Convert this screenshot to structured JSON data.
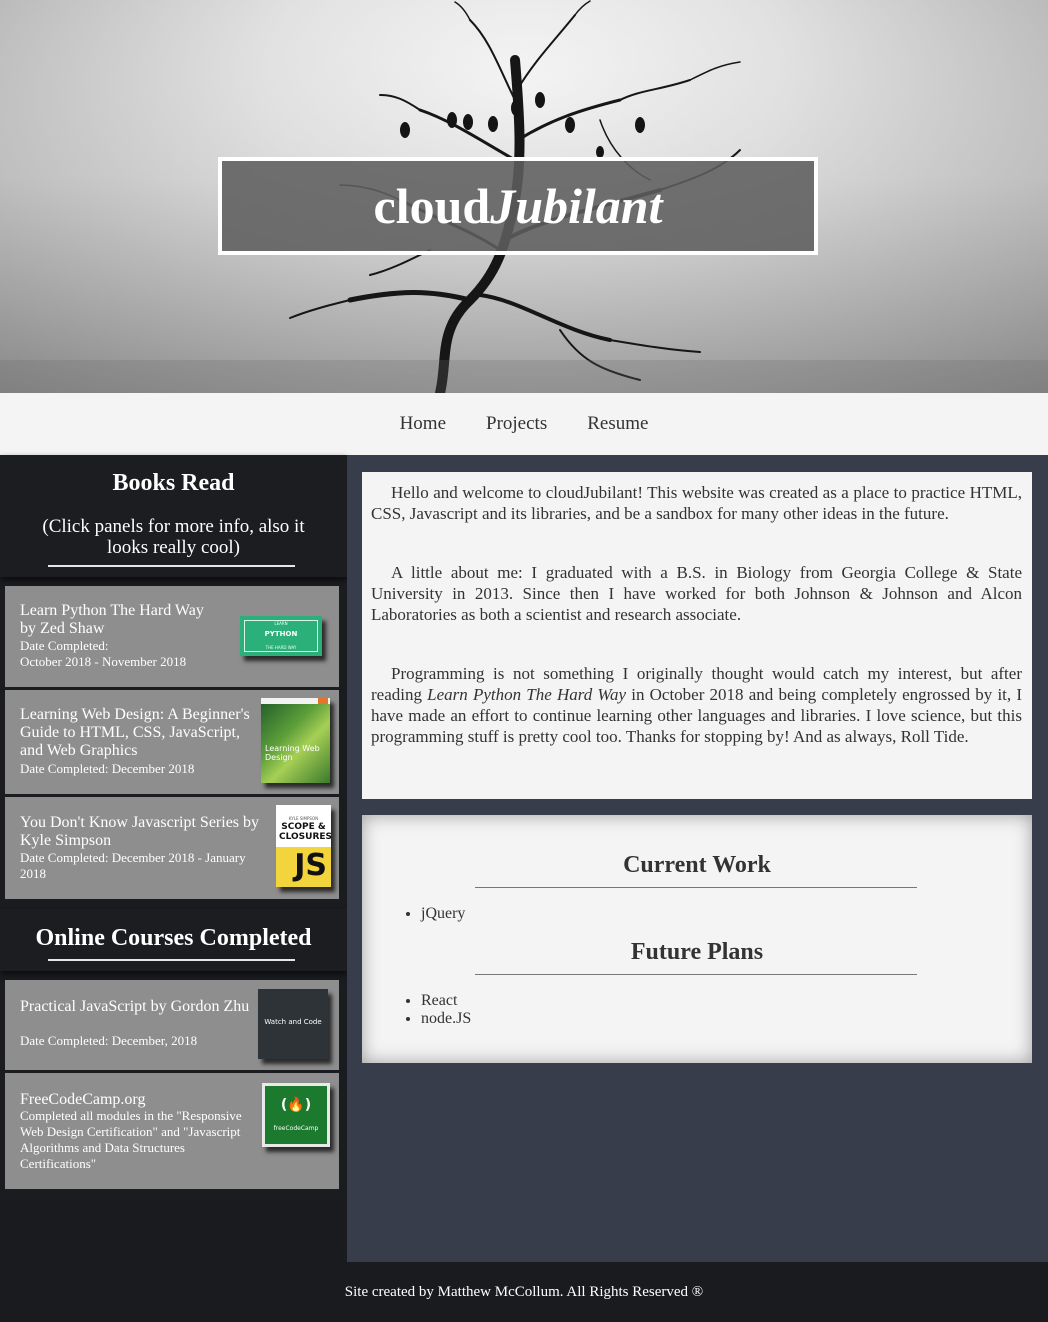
{
  "hero": {
    "title_plain": "cloud",
    "title_italic": "Jubilant"
  },
  "nav": {
    "items": [
      {
        "label": "Home"
      },
      {
        "label": "Projects"
      },
      {
        "label": "Resume"
      }
    ]
  },
  "sidebar": {
    "books": {
      "heading": "Books Read",
      "subheading": "(Click panels for more info, also it looks really cool)",
      "items": [
        {
          "title_line1": "Learn Python The Hard Way",
          "title_line2": "by Zed Shaw",
          "date_label": "Date Completed:",
          "date_value": "October 2018 - November 2018",
          "cover_top": "LEARN",
          "cover_mid": "PYTHON",
          "cover_bottom": "THE HARD WAY"
        },
        {
          "title": "Learning Web Design: A Beginner's Guide to HTML, CSS, JavaScript, and Web Graphics",
          "date": "Date Completed: December 2018",
          "cover_text": "Learning Web Design"
        },
        {
          "title": "You Don't Know Javascript Series by Kyle Simpson",
          "date": "Date Completed: December 2018 - January 2018",
          "cover_author": "KYLE SIMPSON",
          "cover_title": "SCOPE & CLOSURES",
          "cover_js": "JS"
        }
      ]
    },
    "courses": {
      "heading": "Online Courses Completed",
      "items": [
        {
          "title": "Practical JavaScript by Gordon Zhu",
          "date": "Date Completed: December, 2018",
          "cover_text": "Watch and Code"
        },
        {
          "title": "FreeCodeCamp.org",
          "desc": "Completed all modules in the \"Responsive Web Design Certification\" and \"Javascript Algorithms and Data Structures Certifications\"",
          "cover_logo": "(🔥)",
          "cover_text": "freeCodeCamp"
        }
      ]
    }
  },
  "intro": {
    "p1": "Hello and welcome to cloudJubilant! This website was created as a place to practice HTML, CSS, Javascript and its libraries, and be a sandbox for many other ideas in the future.",
    "p2": "A little about me: I graduated with a B.S. in Biology from Georgia College & State University in 2013. Since then I have worked for both Johnson & Johnson and Alcon Laboratories as both a scientist and research associate.",
    "p3_before": "Programming is not something I originally thought would catch my interest, but after reading ",
    "p3_italic": "Learn Python The Hard Way",
    "p3_after": " in October 2018 and being completely engrossed by it, I have made an effort to continue learning other languages and libraries. I love science, but this programming stuff is pretty cool too. Thanks for stopping by! And as always, Roll Tide."
  },
  "plans": {
    "current_heading": "Current Work",
    "current_items": [
      "jQuery"
    ],
    "future_heading": "Future Plans",
    "future_items": [
      "React",
      "node.JS"
    ]
  },
  "footer": {
    "text": "Site created by Matthew McCollum. All Rights Reserved ®"
  }
}
